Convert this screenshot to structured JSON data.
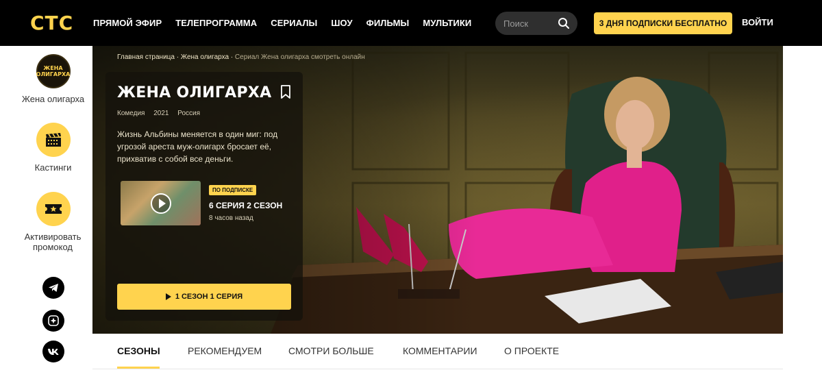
{
  "header": {
    "logo": "СТС",
    "nav": [
      "ПРЯМОЙ ЭФИР",
      "ТЕЛЕПРОГРАММА",
      "СЕРИАЛЫ",
      "ШОУ",
      "ФИЛЬМЫ",
      "МУЛЬТИКИ"
    ],
    "search_placeholder": "Поиск",
    "subscribe_label": "3 ДНЯ ПОДПИСКИ БЕСПЛАТНО",
    "login_label": "ВОЙТИ"
  },
  "colors": {
    "accent": "#ffd34e",
    "header_bg": "#000000"
  },
  "sidebar": {
    "show_thumb_text": [
      "ЖЕНА",
      "ОЛИГАРХА"
    ],
    "items": [
      {
        "label": "Жена олигарха",
        "icon": "show-logo-icon"
      },
      {
        "label": "Кастинги",
        "icon": "clapperboard-icon"
      },
      {
        "label": "Активировать промокод",
        "icon": "ticket-icon"
      }
    ],
    "social": [
      "telegram-icon",
      "star-icon",
      "vk-icon"
    ]
  },
  "hero": {
    "breadcrumb": [
      "Главная страница",
      "Жена олигарха",
      "Сериал Жена олигарха смотреть онлайн"
    ],
    "title": "ЖЕНА ОЛИГАРХА",
    "meta": [
      "Комедия",
      "2021",
      "Россия"
    ],
    "description": "Жизнь Альбины меняется в один миг: под угрозой ареста муж-олигарх бросает её, прихватив с собой все деньги.",
    "episode": {
      "badge": "ПО ПОДПИСКЕ",
      "title": "6 СЕРИЯ 2 СЕЗОН",
      "time": "8 часов назад"
    },
    "watch_label": "1 СЕЗОН 1 СЕРИЯ"
  },
  "tabs": [
    "СЕЗОНЫ",
    "РЕКОМЕНДУЕМ",
    "СМОТРИ БОЛЬШЕ",
    "КОММЕНТАРИИ",
    "О ПРОЕКТЕ"
  ],
  "active_tab": "СЕЗОНЫ"
}
